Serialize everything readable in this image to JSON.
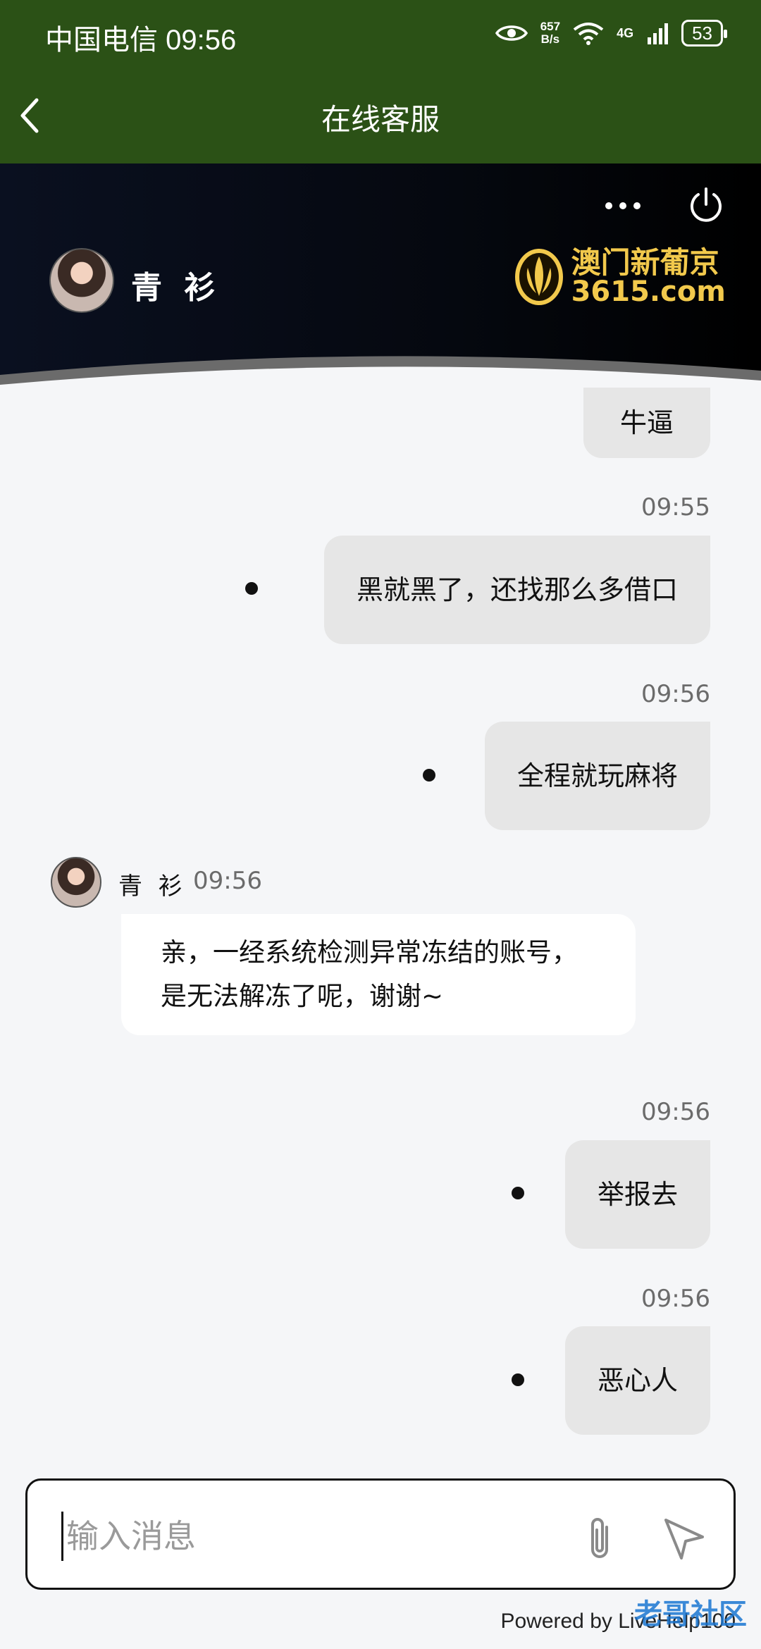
{
  "status_bar": {
    "carrier_time": "中国电信 09:56",
    "net_speed_top": "657",
    "net_speed_unit": "B/s",
    "network": "4G",
    "battery": "53"
  },
  "nav": {
    "title": "在线客服"
  },
  "header": {
    "agent_name": "青 衫",
    "brand_cn": "澳门新葡京",
    "brand_url": "3615.com"
  },
  "messages": {
    "m1": {
      "text": "牛逼"
    },
    "m2": {
      "time": "09:55",
      "text": "黑就黑了，还找那么多借口"
    },
    "m3": {
      "time": "09:56",
      "text": "全程就玩麻将"
    },
    "m4": {
      "sender": "青 衫",
      "time": "09:56",
      "text": "亲，一经系统检测异常冻结的账号，是无法解冻了呢，谢谢~"
    },
    "m5": {
      "time": "09:56",
      "text": "举报去"
    },
    "m6": {
      "time": "09:56",
      "text": "恶心人"
    }
  },
  "composer": {
    "placeholder": "输入消息"
  },
  "footer": {
    "powered": "Powered by LiveHelp100",
    "watermark": "老哥社区"
  },
  "colors": {
    "topbar": "#2b5116",
    "brand_gold": "#f2c94c",
    "bubble_out": "#e6e6e6",
    "bubble_in": "#ffffff"
  }
}
